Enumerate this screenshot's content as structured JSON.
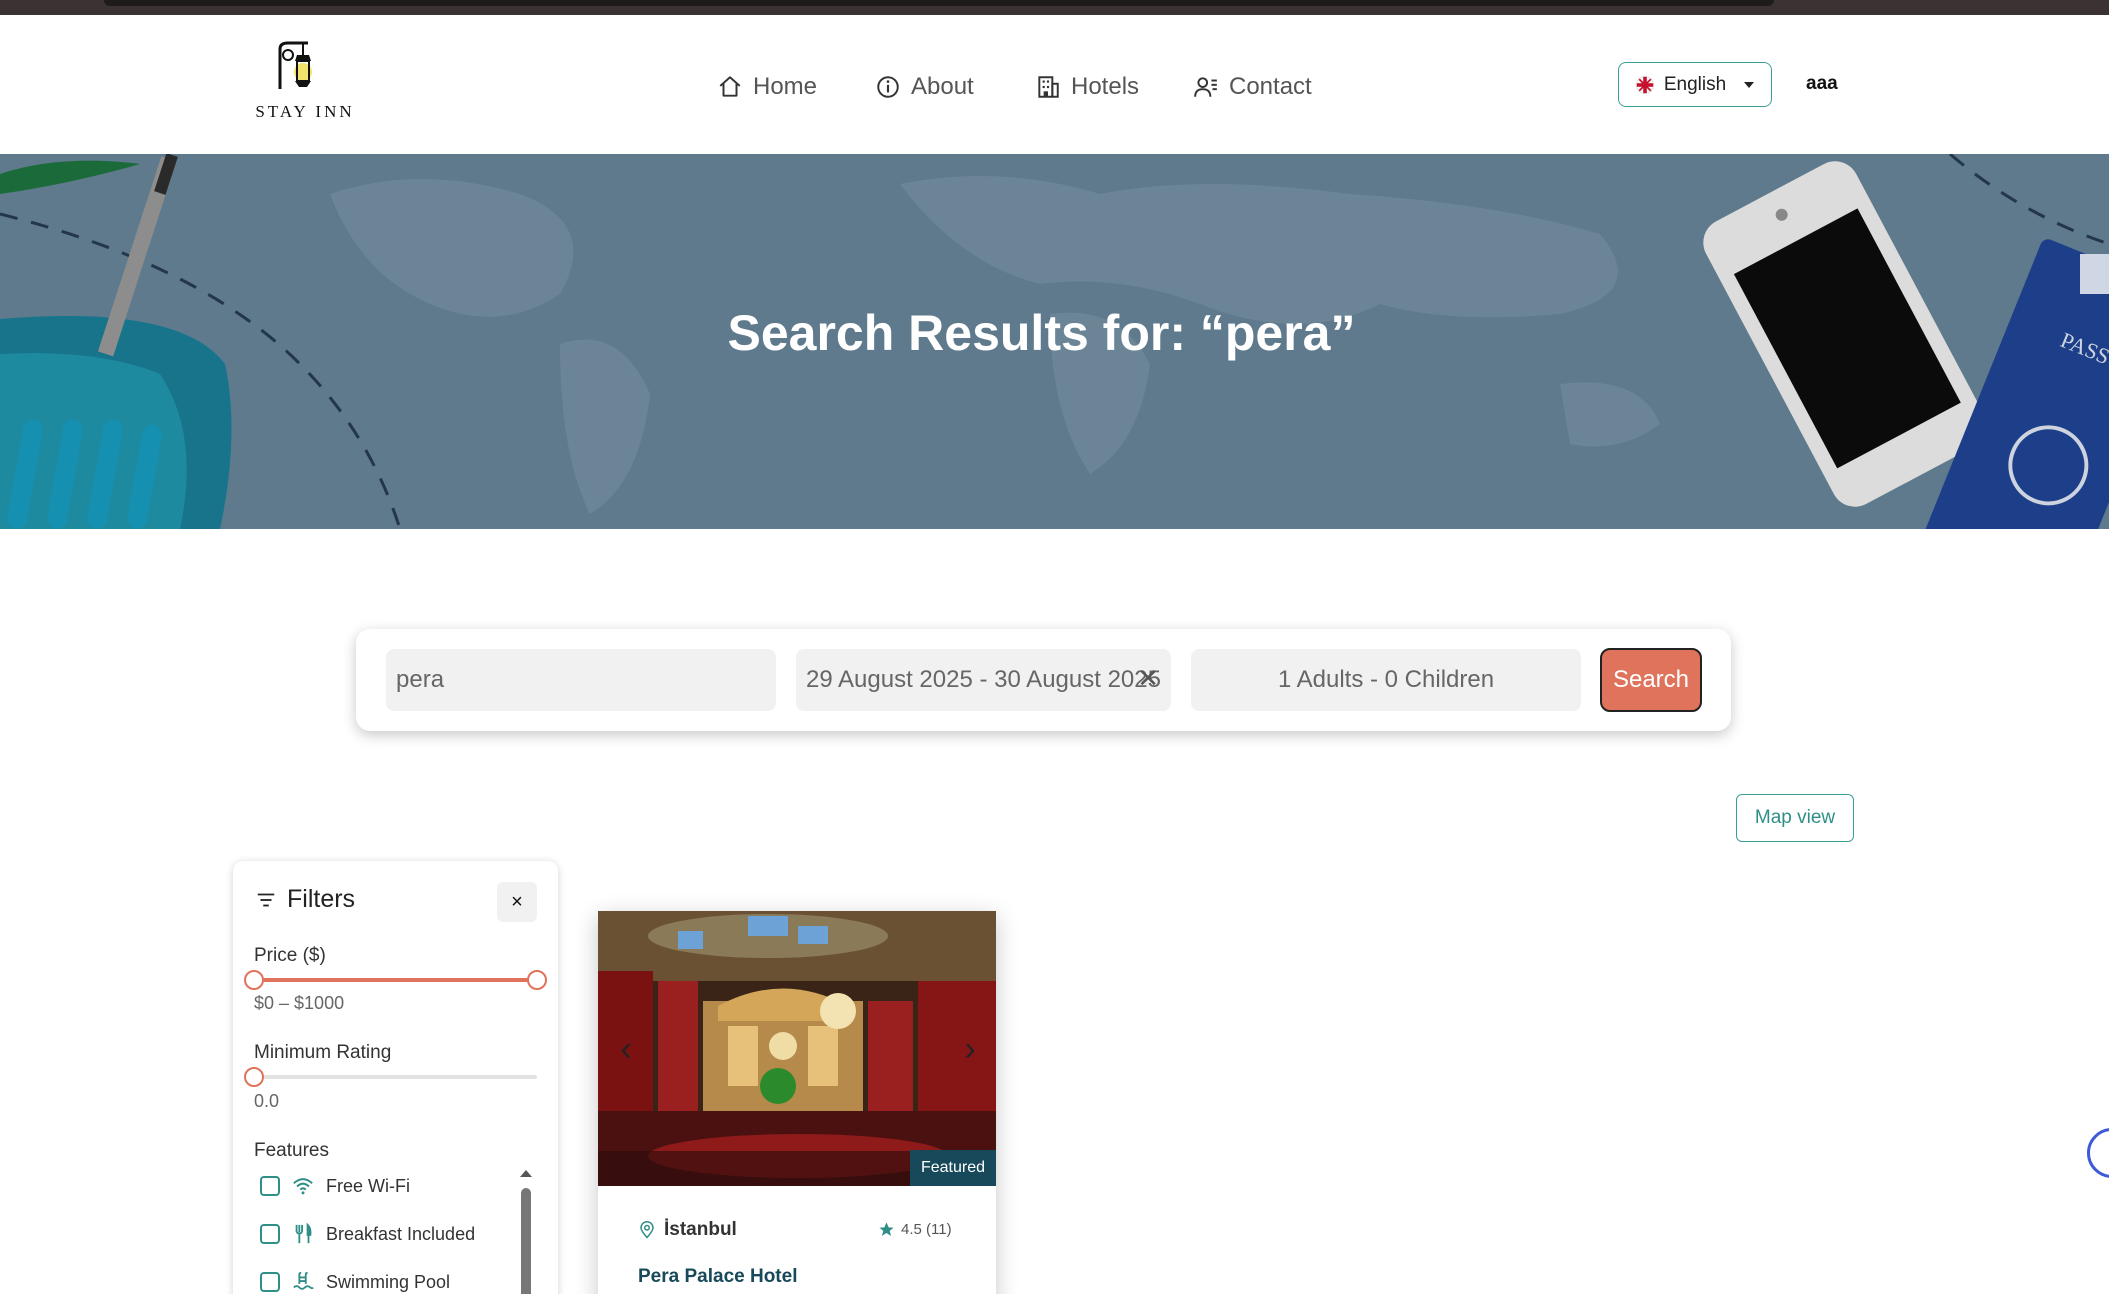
{
  "header": {
    "logo_text": "STAY INN",
    "nav": [
      {
        "label": "Home",
        "icon": "home-icon"
      },
      {
        "label": "About",
        "icon": "info-icon"
      },
      {
        "label": "Hotels",
        "icon": "building-icon"
      },
      {
        "label": "Contact",
        "icon": "contact-icon"
      }
    ],
    "language": "English",
    "username": "aaa"
  },
  "hero": {
    "title": "Search Results for: “pera”"
  },
  "search": {
    "location": "pera",
    "dates": "29 August 2025 - 30 August 2025",
    "guests": "1 Adults - 0 Children",
    "button": "Search"
  },
  "map_view_label": "Map view",
  "filters": {
    "title": "Filters",
    "close": "×",
    "price_label": "Price ($)",
    "price_range": "$0 – $1000",
    "price_min": 0,
    "price_max": 1000,
    "rating_label": "Minimum Rating",
    "rating_value": "0.0",
    "features_label": "Features",
    "features": [
      {
        "label": "Free Wi-Fi",
        "icon": "wifi-icon"
      },
      {
        "label": "Breakfast Included",
        "icon": "utensils-icon"
      },
      {
        "label": "Swimming Pool",
        "icon": "pool-icon"
      }
    ]
  },
  "hotel_card": {
    "badge": "Featured",
    "city": "İstanbul",
    "rating": "4.5 (11)",
    "name": "Pera Palace Hotel"
  },
  "colors": {
    "accent_teal": "#3a9f97",
    "accent_coral": "#e0735c",
    "hero_overlay": "#5f7a8c",
    "featured_badge": "#17495a"
  }
}
